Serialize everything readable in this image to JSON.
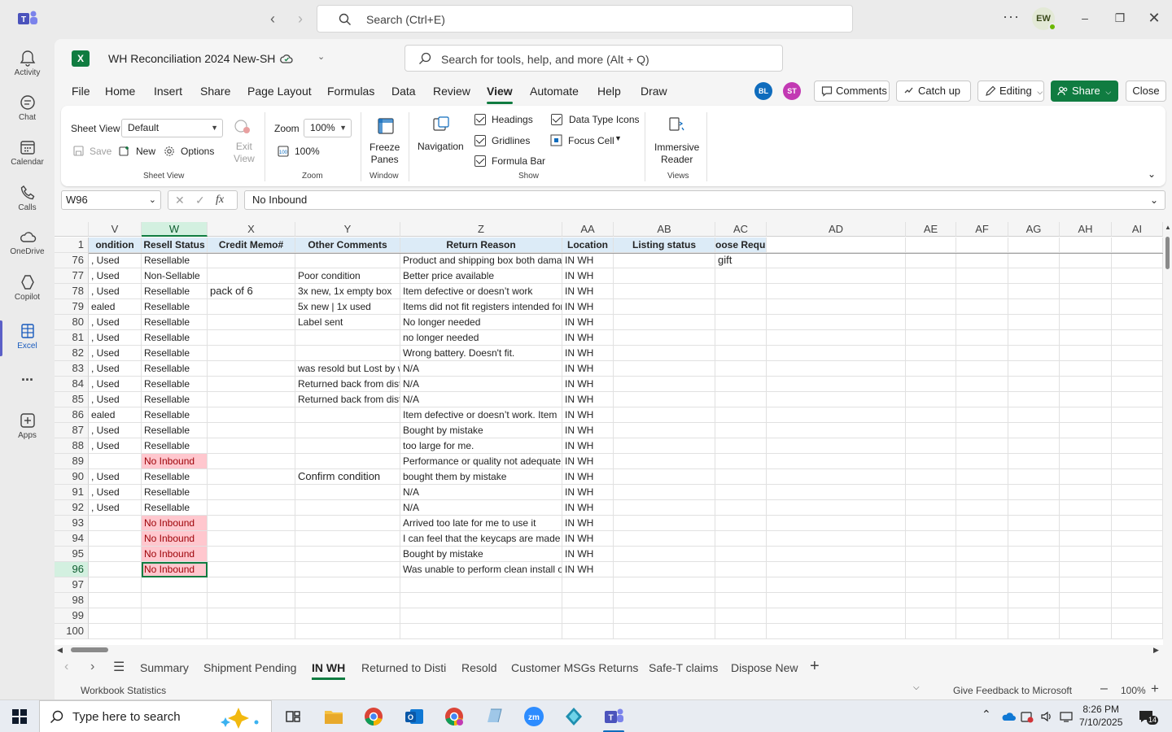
{
  "teams": {
    "search_placeholder": "Search (Ctrl+E)",
    "user_initials": "EW",
    "rail": [
      {
        "label": "Activity",
        "icon": "bell-icon"
      },
      {
        "label": "Chat",
        "icon": "chat-icon"
      },
      {
        "label": "Calendar",
        "icon": "calendar-icon"
      },
      {
        "label": "Calls",
        "icon": "phone-icon"
      },
      {
        "label": "OneDrive",
        "icon": "cloud-icon"
      },
      {
        "label": "Copilot",
        "icon": "copilot-icon"
      },
      {
        "label": "Excel",
        "icon": "excel-icon"
      },
      {
        "label": "...",
        "icon": "more-icon"
      },
      {
        "label": "Apps",
        "icon": "apps-icon"
      }
    ]
  },
  "excel": {
    "workbook_name": "WH Reconciliation 2024 New-SH",
    "tool_search_placeholder": "Search for tools, help, and more (Alt + Q)",
    "menu_tabs": [
      "File",
      "Home",
      "Insert",
      "Share",
      "Page Layout",
      "Formulas",
      "Data",
      "Review",
      "View",
      "Automate",
      "Help",
      "Draw"
    ],
    "active_menu_tab": "View",
    "collaborators": [
      "BL",
      "ST"
    ],
    "buttons": {
      "comments": "Comments",
      "catch_up": "Catch up",
      "editing": "Editing",
      "share": "Share",
      "close": "Close"
    },
    "ribbon": {
      "sheet_view_label": "Sheet View",
      "sheet_view_value": "Default",
      "save": "Save",
      "new": "New",
      "options": "Options",
      "exit_view": "Exit\nView",
      "group_sheet_view": "Sheet View",
      "zoom_label": "Zoom",
      "zoom_value": "100%",
      "zoom_100": "100%",
      "group_zoom": "Zoom",
      "freeze_panes": "Freeze\nPanes",
      "group_window": "Window",
      "navigation": "Navigation",
      "headings": "Headings",
      "gridlines": "Gridlines",
      "formula_bar": "Formula Bar",
      "data_type_icons": "Data Type Icons",
      "focus_cell": "Focus Cell",
      "group_show": "Show",
      "immersive_reader": "Immersive\nReader",
      "group_views": "Views"
    },
    "name_box": "W96",
    "formula_value": "No Inbound",
    "colors": {
      "accent": "#107c41",
      "pink_fill": "#ffc7ce",
      "pink_text": "#9c0006",
      "header_fill": "#dcebf7"
    }
  },
  "grid": {
    "columns": [
      "V",
      "W",
      "X",
      "Y",
      "Z",
      "AA",
      "AB",
      "AC",
      "AD",
      "AE",
      "AF",
      "AG",
      "AH",
      "AI"
    ],
    "header_row": {
      "num": "1",
      "cells": [
        "ondition",
        "Resell Status",
        "Credit Memo#",
        "Other Comments",
        "Return Reason",
        "Location",
        "Listing status",
        "oose Required"
      ]
    },
    "rows": [
      {
        "num": "76",
        "v": ", Used",
        "w": "Resellable",
        "x": "",
        "y": "",
        "z": "Product and shipping box both damaged",
        "aa": "IN WH",
        "ab": "",
        "ac": "gift"
      },
      {
        "num": "77",
        "v": ", Used",
        "w": "Non-Sellable",
        "x": "",
        "y": "Poor condition",
        "z": "Better price available",
        "aa": "IN WH",
        "ab": "",
        "ac": ""
      },
      {
        "num": "78",
        "v": ", Used",
        "w": "Resellable",
        "x": "pack of 6",
        "y": "3x new, 1x empty box",
        "z": "Item defective or doesn’t work",
        "aa": "IN WH",
        "ab": "",
        "ac": ""
      },
      {
        "num": "79",
        "v": "ealed",
        "w": "Resellable",
        "x": "",
        "y": "5x new | 1x used",
        "z": "Items did not fit registers intended for",
        "aa": "IN WH",
        "ab": "",
        "ac": ""
      },
      {
        "num": "80",
        "v": ", Used",
        "w": "Resellable",
        "x": "",
        "y": "Label sent",
        "z": "No longer needed",
        "aa": "IN WH",
        "ab": "",
        "ac": ""
      },
      {
        "num": "81",
        "v": ", Used",
        "w": "Resellable",
        "x": "",
        "y": "",
        "z": "no longer needed",
        "aa": "IN WH",
        "ab": "",
        "ac": ""
      },
      {
        "num": "82",
        "v": ", Used",
        "w": "Resellable",
        "x": "",
        "y": "",
        "z": "Wrong battery.  Doesn't fit.",
        "aa": "IN WH",
        "ab": "",
        "ac": ""
      },
      {
        "num": "83",
        "v": ", Used",
        "w": "Resellable",
        "x": "",
        "y": "was resold but Lost by w",
        "z": "N/A",
        "aa": "IN WH",
        "ab": "",
        "ac": ""
      },
      {
        "num": "84",
        "v": ", Used",
        "w": "Resellable",
        "x": "",
        "y": "Returned back from dist",
        "z": "N/A",
        "aa": "IN WH",
        "ab": "",
        "ac": ""
      },
      {
        "num": "85",
        "v": ", Used",
        "w": "Resellable",
        "x": "",
        "y": "Returned back from dist",
        "z": "N/A",
        "aa": "IN WH",
        "ab": "",
        "ac": ""
      },
      {
        "num": "86",
        "v": "ealed",
        "w": "Resellable",
        "x": "",
        "y": "",
        "z": "Item defective or doesn’t work. Item",
        "aa": "IN WH",
        "ab": "",
        "ac": ""
      },
      {
        "num": "87",
        "v": ", Used",
        "w": "Resellable",
        "x": "",
        "y": "",
        "z": "Bought by mistake",
        "aa": "IN WH",
        "ab": "",
        "ac": ""
      },
      {
        "num": "88",
        "v": ", Used",
        "w": "Resellable",
        "x": "",
        "y": "",
        "z": "too large for me.",
        "aa": "IN WH",
        "ab": "",
        "ac": ""
      },
      {
        "num": "89",
        "v": "",
        "w": "No Inbound",
        "x": "",
        "y": "",
        "z": "Performance or quality not adequate",
        "aa": "IN WH",
        "ab": "",
        "ac": ""
      },
      {
        "num": "90",
        "v": ", Used",
        "w": "Resellable",
        "x": "",
        "y": "Confirm condition",
        "z": "bought them by mistake",
        "aa": "IN WH",
        "ab": "",
        "ac": ""
      },
      {
        "num": "91",
        "v": ", Used",
        "w": "Resellable",
        "x": "",
        "y": "",
        "z": "N/A",
        "aa": "IN WH",
        "ab": "",
        "ac": ""
      },
      {
        "num": "92",
        "v": ", Used",
        "w": "Resellable",
        "x": "",
        "y": "",
        "z": "N/A",
        "aa": "IN WH",
        "ab": "",
        "ac": ""
      },
      {
        "num": "93",
        "v": "",
        "w": "No Inbound",
        "x": "",
        "y": "",
        "z": "Arrived too late for me to use it",
        "aa": "IN WH",
        "ab": "",
        "ac": ""
      },
      {
        "num": "94",
        "v": "",
        "w": "No Inbound",
        "x": "",
        "y": "",
        "z": "I can feel that the keycaps are made",
        "aa": "IN WH",
        "ab": "",
        "ac": ""
      },
      {
        "num": "95",
        "v": "",
        "w": "No Inbound",
        "x": "",
        "y": "",
        "z": "Bought by mistake",
        "aa": "IN WH",
        "ab": "",
        "ac": ""
      },
      {
        "num": "96",
        "v": "",
        "w": "No Inbound",
        "x": "",
        "y": "",
        "z": "Was unable to perform clean install of",
        "aa": "IN WH",
        "ab": "",
        "ac": ""
      },
      {
        "num": "97",
        "v": "",
        "w": "",
        "x": "",
        "y": "",
        "z": "",
        "aa": "",
        "ab": "",
        "ac": ""
      },
      {
        "num": "98",
        "v": "",
        "w": "",
        "x": "",
        "y": "",
        "z": "",
        "aa": "",
        "ab": "",
        "ac": ""
      },
      {
        "num": "99",
        "v": "",
        "w": "",
        "x": "",
        "y": "",
        "z": "",
        "aa": "",
        "ab": "",
        "ac": ""
      },
      {
        "num": "100",
        "v": "",
        "w": "",
        "x": "",
        "y": "",
        "z": "",
        "aa": "",
        "ab": "",
        "ac": ""
      }
    ]
  },
  "sheet_tabs": [
    "Summary",
    "Shipment Pending",
    "IN WH",
    "Returned to Disti",
    "Resold",
    "Customer MSGs Returns",
    "Safe-T claims",
    "Dispose New"
  ],
  "active_sheet": "IN WH",
  "status": {
    "left": "Workbook Statistics",
    "feedback": "Give Feedback to Microsoft",
    "zoom": "100%"
  },
  "taskbar": {
    "search_placeholder": "Type here to search",
    "time": "8:26 PM",
    "date": "7/10/2025",
    "notif_count": "14"
  }
}
